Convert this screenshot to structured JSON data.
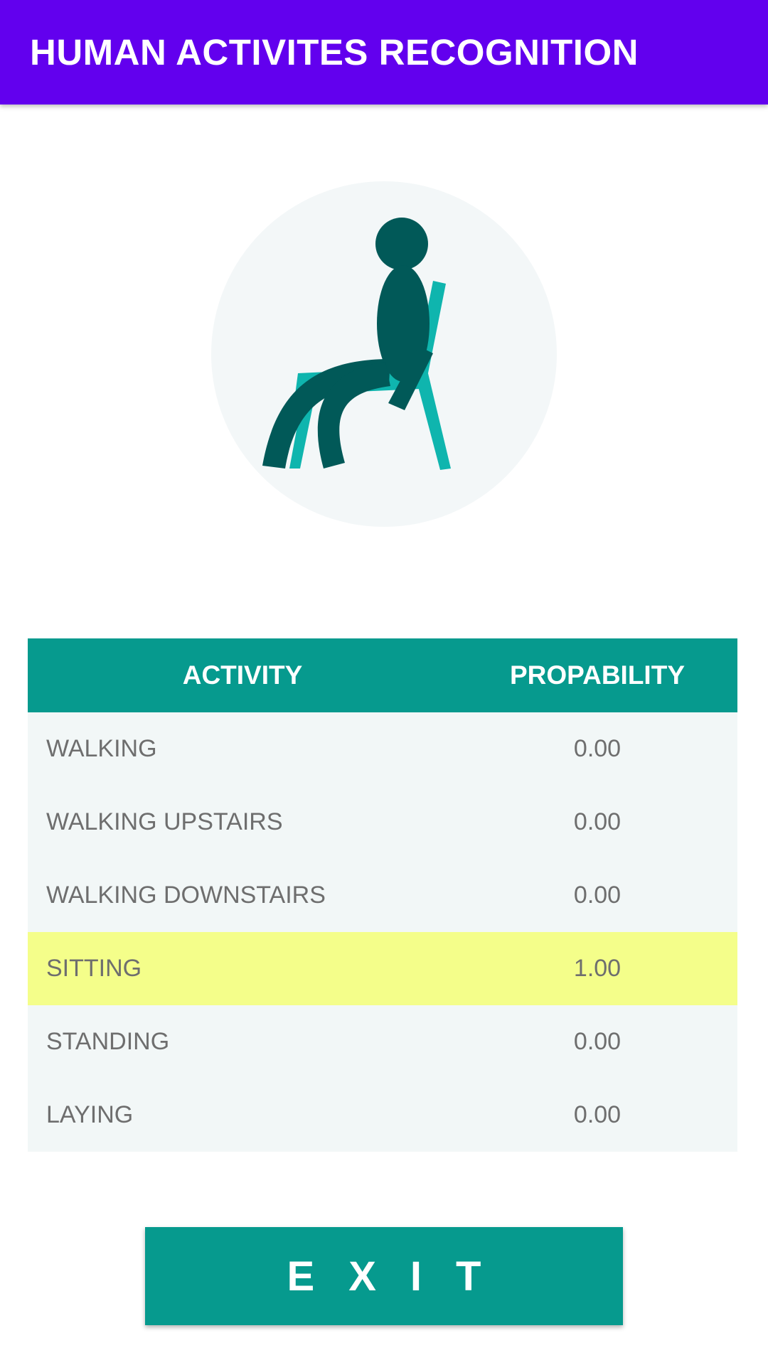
{
  "app_bar": {
    "title": "HUMAN ACTIVITES RECOGNITION",
    "background_color": "#6200EE"
  },
  "illustration": {
    "icon": "person-sitting-on-chair-icon",
    "circle_color": "#F3F7F8",
    "person_color": "#015958",
    "chair_color": "#0FB5AE"
  },
  "table": {
    "header_color": "#069A8E",
    "highlight_color": "#F4FE8A",
    "headers": {
      "activity": "ACTIVITY",
      "probability": "PROPABILITY"
    },
    "rows": [
      {
        "activity": "WALKING",
        "probability": "0.00"
      },
      {
        "activity": "WALKING UPSTAIRS",
        "probability": "0.00"
      },
      {
        "activity": "WALKING DOWNSTAIRS",
        "probability": "0.00"
      },
      {
        "activity": "SITTING",
        "probability": "1.00"
      },
      {
        "activity": "STANDING",
        "probability": "0.00"
      },
      {
        "activity": "LAYING",
        "probability": "0.00"
      }
    ]
  },
  "exit_button": {
    "label": "EXIT"
  }
}
